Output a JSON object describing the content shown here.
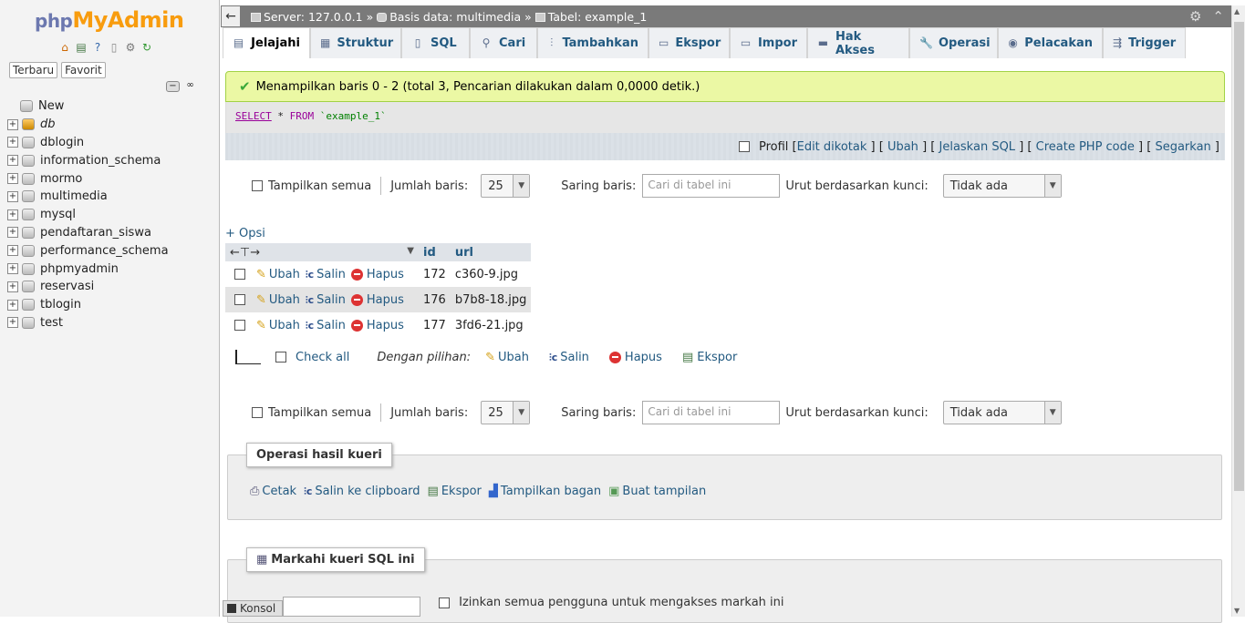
{
  "sidebar": {
    "logo": {
      "php": "php",
      "my": "My",
      "admin": "Admin"
    },
    "tabs": [
      "Terbaru",
      "Favorit"
    ],
    "new_label": "New",
    "databases": [
      "db",
      "dblogin",
      "information_schema",
      "mormo",
      "multimedia",
      "mysql",
      "pendaftaran_siswa",
      "performance_schema",
      "phpmyadmin",
      "reservasi",
      "tblogin",
      "test"
    ]
  },
  "topbar": {
    "server": "Server: 127.0.0.1",
    "database": "Basis data: multimedia",
    "table": "Tabel: example_1",
    "sep": "»"
  },
  "tabs": [
    {
      "label": "Jelajahi",
      "icon": "browse-icon"
    },
    {
      "label": "Struktur",
      "icon": "structure-icon"
    },
    {
      "label": "SQL",
      "icon": "sql-icon"
    },
    {
      "label": "Cari",
      "icon": "search-icon"
    },
    {
      "label": "Tambahkan",
      "icon": "insert-icon"
    },
    {
      "label": "Ekspor",
      "icon": "export-icon"
    },
    {
      "label": "Impor",
      "icon": "import-icon"
    },
    {
      "label": "Hak Akses",
      "icon": "privileges-icon"
    },
    {
      "label": "Operasi",
      "icon": "operations-icon"
    },
    {
      "label": "Pelacakan",
      "icon": "tracking-icon"
    },
    {
      "label": "Trigger",
      "icon": "triggers-icon"
    }
  ],
  "message": "Menampilkan baris 0 - 2 (total 3, Pencarian dilakukan dalam 0,0000 detik.)",
  "sql": {
    "select": "SELECT",
    "star": " * ",
    "from": "FROM",
    "table": " `example_1`"
  },
  "tools": {
    "profil": "Profil",
    "edit_inline": "Edit dikotak",
    "edit": "Ubah",
    "explain": "Jelaskan SQL",
    "create_php": "Create PHP code",
    "refresh": "Segarkan",
    "open": "[",
    "close": "]",
    "mid": "] [",
    "tail": "]"
  },
  "navbar": {
    "show_all": "Tampilkan semua",
    "rows_label": "Jumlah baris:",
    "rows_value": "25",
    "filter_label": "Saring baris:",
    "filter_placeholder": "Cari di tabel ini",
    "sort_label": "Urut berdasarkan kunci:",
    "sort_value": "Tidak ada"
  },
  "opsi": "+ Opsi",
  "table": {
    "columns": [
      "id",
      "url"
    ],
    "action_labels": {
      "edit": "Ubah",
      "copy": "Salin",
      "delete": "Hapus"
    },
    "rows": [
      {
        "id": "172",
        "url": "c360-9.jpg"
      },
      {
        "id": "176",
        "url": "b7b8-18.jpg"
      },
      {
        "id": "177",
        "url": "3fd6-21.jpg"
      }
    ]
  },
  "with_selected": {
    "check_all": "Check all",
    "label": "Dengan pilihan:",
    "edit": "Ubah",
    "copy": "Salin",
    "delete": "Hapus",
    "export": "Ekspor"
  },
  "query_ops": {
    "legend": "Operasi hasil kueri",
    "print": "Cetak",
    "copy_clipboard": "Salin ke clipboard",
    "export": "Ekspor",
    "chart": "Tampilkan bagan",
    "create_view": "Buat tampilan"
  },
  "bookmark": {
    "legend": "Markahi kueri SQL ini",
    "allow_all": "Izinkan semua pengguna untuk mengakses markah ini"
  },
  "konsol": "Konsol"
}
